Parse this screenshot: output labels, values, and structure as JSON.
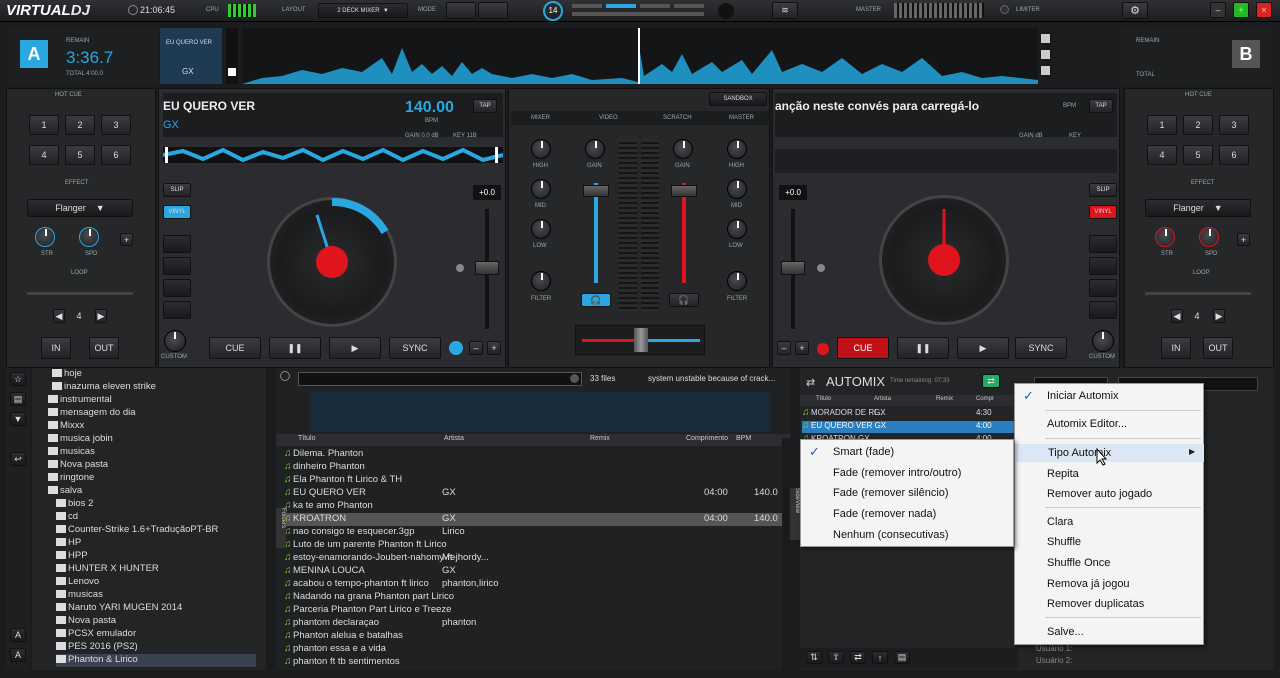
{
  "app": {
    "logo_a": "VIRTUAL",
    "logo_b": "DJ",
    "clock": "21:06:45",
    "cpu_label": "CPU",
    "layout_label": "LAYOUT",
    "layout_value": "2 DECK MIXER",
    "mode_label": "MODE",
    "master_label": "MASTER",
    "limiter_label": "LIMITER",
    "badge_count": "14"
  },
  "deckA": {
    "letter": "A",
    "remain_label": "REMAIN",
    "time": "3:36.7",
    "total": "TOTAL  4:00.0",
    "mini_title": "EU QUERO VER",
    "mini_artist": "GX",
    "title": "EU QUERO VER",
    "artist": "GX",
    "bpm": "140.00",
    "bpm_label": "BPM",
    "tap": "TAP",
    "gain": "GAIN  0.0 dB",
    "key": "KEY  11B",
    "pitch": "+0.0",
    "slip": "SLIP",
    "vinyl": "VINYL",
    "cue": "CUE",
    "play_pause": "❚❚",
    "play": "▶",
    "sync": "SYNC",
    "custom": "CUSTOM"
  },
  "deckB": {
    "letter": "B",
    "remain_label": "REMAIN",
    "total": "TOTAL",
    "title": "anção neste convés para carregá-lo",
    "bpm_label": "BPM",
    "tap": "TAP",
    "gain": "GAIN    dB",
    "key": "KEY",
    "pitch": "+0.0",
    "slip": "SLIP",
    "vinyl": "VINYL",
    "cue": "CUE",
    "sync": "SYNC",
    "custom": "CUSTOM"
  },
  "leftpanel": {
    "hotcue": "HOT CUE",
    "effect": "EFFECT",
    "effect_value": "Flanger",
    "str": "STR",
    "spd": "SPD",
    "loop": "LOOP",
    "loop_value": "4",
    "in": "IN",
    "out": "OUT",
    "cues": [
      "1",
      "2",
      "3",
      "4",
      "5",
      "6"
    ]
  },
  "rightpanel": {
    "hotcue": "HOT CUE",
    "effect": "EFFECT",
    "effect_value": "Flanger",
    "str": "STR",
    "spd": "SPD",
    "loop": "LOOP",
    "loop_value": "4",
    "in": "IN",
    "out": "OUT",
    "cues": [
      "1",
      "2",
      "3",
      "4",
      "5",
      "6"
    ]
  },
  "mixer": {
    "sandbox": "SANDBOX",
    "tabs": [
      "MIXER",
      "VIDEO",
      "SCRATCH",
      "MASTER"
    ],
    "high": "HIGH",
    "mid": "MID",
    "low": "LOW",
    "filter": "FILTER",
    "gain": "GAIN"
  },
  "browser": {
    "files": "33 files",
    "status": "system unstable because of crack...",
    "headers": [
      "Título",
      "Artista",
      "Remix",
      "Comprimento",
      "BPM"
    ],
    "rows": [
      {
        "t": "Dilema. Phanton",
        "a": "",
        "l": "",
        "b": ""
      },
      {
        "t": "dinheiro Phanton",
        "a": "",
        "l": "",
        "b": ""
      },
      {
        "t": "Ela Phanton ft Lirico & TH",
        "a": "",
        "l": "",
        "b": ""
      },
      {
        "t": "EU QUERO VER",
        "a": "GX",
        "l": "04:00",
        "b": "140.0"
      },
      {
        "t": "ka te amo Phanton",
        "a": "",
        "l": "",
        "b": ""
      },
      {
        "t": "KROATRON",
        "a": "GX",
        "l": "04:00",
        "b": "140.0"
      },
      {
        "t": "nao consigo te esquecer.3gp",
        "a": "Lirico",
        "l": "",
        "b": ""
      },
      {
        "t": "Luto de um parente Phanton ft Lirico",
        "a": "",
        "l": "",
        "b": ""
      },
      {
        "t": "estoy-enamorando-Joubert-nahomy-ft-jhordy...",
        "a": "Me",
        "l": "",
        "b": ""
      },
      {
        "t": "MENINA LOUCA",
        "a": "GX",
        "l": "",
        "b": ""
      },
      {
        "t": "acabou o tempo-phanton ft lirico",
        "a": "phanton,lirico",
        "l": "",
        "b": ""
      },
      {
        "t": "Nadando na grana Phanton part Lirico",
        "a": "",
        "l": "",
        "b": ""
      },
      {
        "t": "Parceria Phanton Part Lirico e Treeze",
        "a": "",
        "l": "",
        "b": ""
      },
      {
        "t": "phantom declaraçao",
        "a": "phanton",
        "l": "",
        "b": ""
      },
      {
        "t": "Phanton alelua e batalhas",
        "a": "",
        "l": "",
        "b": ""
      },
      {
        "t": "phanton essa e a vida",
        "a": "",
        "l": "",
        "b": ""
      },
      {
        "t": "phanton ft tb sentimentos",
        "a": "",
        "l": "",
        "b": ""
      }
    ]
  },
  "folders": [
    "hoje",
    "inazuma eleven strike",
    "instrumental",
    "mensagem do dia",
    "Mixxx",
    "musica jobin",
    "musicas",
    "Nova pasta",
    "ringtone",
    "salva",
    "bios 2",
    "cd",
    "Counter-Strike 1.6+TraduçãoPT-BR",
    "HP",
    "HPP",
    "HUNTER X HUNTER",
    "Lenovo",
    "musicas",
    "Naruto YARI MUGEN 2014",
    "Nova pasta",
    "PCSX emulador",
    "PES 2016 (PS2)",
    "Phanton & Lirico"
  ],
  "automix": {
    "title": "AUTOMIX",
    "remaining": "Time remaining: 07:33",
    "headers": [
      "Título",
      "Artista",
      "Remix",
      "Compr"
    ],
    "rows": [
      {
        "t": "MORADOR DE RI...",
        "a": "GX",
        "l": "4:30"
      },
      {
        "t": "EU QUERO VER GX",
        "a": "",
        "l": "4:00"
      },
      {
        "t": "KROATRON GX",
        "a": "",
        "l": "4:00"
      }
    ],
    "users": [
      "Usuário 1:",
      "Usuário 2:"
    ]
  },
  "menu_main": {
    "items": [
      "Iniciar Automix",
      "Automix Editor...",
      "Tipo Automix",
      "Repita",
      "Remover auto jogado",
      "Clara",
      "Shuffle",
      "Shuffle Once",
      "Remova já jogou",
      "Remover duplicatas",
      "Salve..."
    ]
  },
  "menu_sub": {
    "items": [
      "Smart (fade)",
      "Fade (remover intro/outro)",
      "Fade (remover silêncio)",
      "Fade (remover nada)",
      "Nenhum (consecutivas)"
    ]
  },
  "colors": {
    "accent": "#2aa7e0",
    "red": "#e0141c",
    "green": "#33cc33"
  }
}
